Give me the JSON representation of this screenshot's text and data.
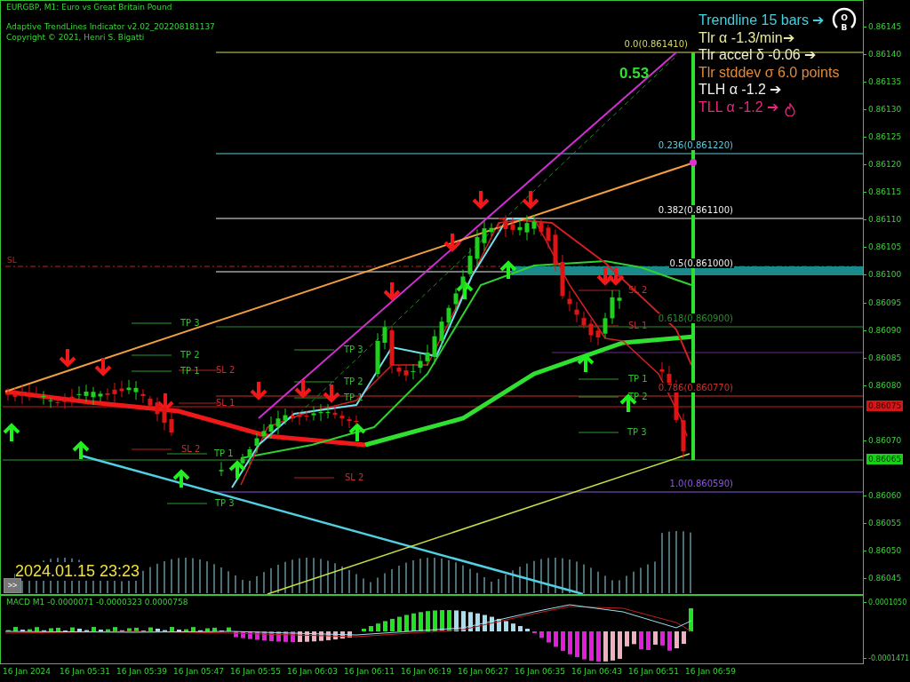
{
  "header": {
    "symbol": "EURGBP, M1:  Euro vs Great Britain Pound",
    "indicator": "Adaptive TrendLines Indicator v2.02_202208181137",
    "copyright": "Copyright © 2021, Henri S. Bigatti"
  },
  "info_panel": [
    {
      "text": "Trendline 15 bars ➔",
      "color": "#40d0e0"
    },
    {
      "text": "Tlr α -1.3/min➔",
      "color": "#e8e8a0"
    },
    {
      "text": "Tlr accel δ -0.06 ➔",
      "color": "#f0f0c8"
    },
    {
      "text": "Tlr stddev σ 6.0 points",
      "color": "#e08a3a"
    },
    {
      "text": "TLH α -1.2 ➔",
      "color": "#f0f0f0"
    },
    {
      "text": "TLL α -1.2 ➔",
      "color": "#e8287e"
    }
  ],
  "ratio": "0.53",
  "logo": {
    "letters": [
      "O",
      "B"
    ]
  },
  "fib_levels": [
    {
      "label": "0.0(0.861410)",
      "color": "#d8d860"
    },
    {
      "label": "0.236(0.861220)",
      "color": "#60c8d8"
    },
    {
      "label": "0.382(0.861100)",
      "color": "#f0f0f0"
    },
    {
      "label": "0.5(0.861000)",
      "color": "#f0f0f0"
    },
    {
      "label": "0.618(0.860900)",
      "color": "#2e8b2e"
    },
    {
      "label": "0.786(0.860770)",
      "color": "#c83030"
    },
    {
      "label": "1.0(0.860590)",
      "color": "#8a5ad8"
    }
  ],
  "sl_marker": "SL",
  "trade_labels": [
    {
      "text": "TP 3",
      "kind": "tp"
    },
    {
      "text": "TP 2",
      "kind": "tp"
    },
    {
      "text": "TP 1",
      "kind": "tp"
    },
    {
      "text": "SL 2",
      "kind": "sl"
    },
    {
      "text": "SL 1",
      "kind": "sl"
    },
    {
      "text": "SL 2",
      "kind": "sl"
    },
    {
      "text": "TP 1",
      "kind": "tp"
    },
    {
      "text": "TP 3",
      "kind": "tp"
    },
    {
      "text": "TP 3",
      "kind": "tp"
    },
    {
      "text": "TP 2",
      "kind": "tp"
    },
    {
      "text": "TP 1",
      "kind": "tp"
    },
    {
      "text": "SL 2",
      "kind": "sl"
    },
    {
      "text": "SL 2",
      "kind": "sl"
    },
    {
      "text": "SL 1",
      "kind": "sl"
    },
    {
      "text": "TP 1",
      "kind": "tp"
    },
    {
      "text": "TP 2",
      "kind": "tp"
    },
    {
      "text": "TP 3",
      "kind": "tp"
    }
  ],
  "timestamp": "2024.01.15 23:23",
  "scroll_button": ">>",
  "price_axis": {
    "ticks": [
      "0.86145",
      "0.86140",
      "0.86135",
      "0.86130",
      "0.86125",
      "0.86120",
      "0.86115",
      "0.86110",
      "0.86105",
      "0.86100",
      "0.86095",
      "0.86090",
      "0.86085",
      "0.86080",
      "0.86070",
      "0.86060",
      "0.86055",
      "0.86050",
      "0.86045"
    ],
    "tags": [
      {
        "text": "0.86075",
        "color": "#d01818"
      },
      {
        "text": "0.86065",
        "color": "#18d018"
      }
    ]
  },
  "macd": {
    "title": "MACD M1 -0.0000071 -0.0000323 0.0000758",
    "top_label": "0.0001050",
    "bottom_label": "-0.0001471"
  },
  "time_axis": [
    "16 Jan 2024",
    "16 Jan 05:31",
    "16 Jan 05:39",
    "16 Jan 05:47",
    "16 Jan 05:55",
    "16 Jan 06:03",
    "16 Jan 06:11",
    "16 Jan 06:19",
    "16 Jan 06:27",
    "16 Jan 06:35",
    "16 Jan 06:43",
    "16 Jan 06:51",
    "16 Jan 06:59"
  ]
}
